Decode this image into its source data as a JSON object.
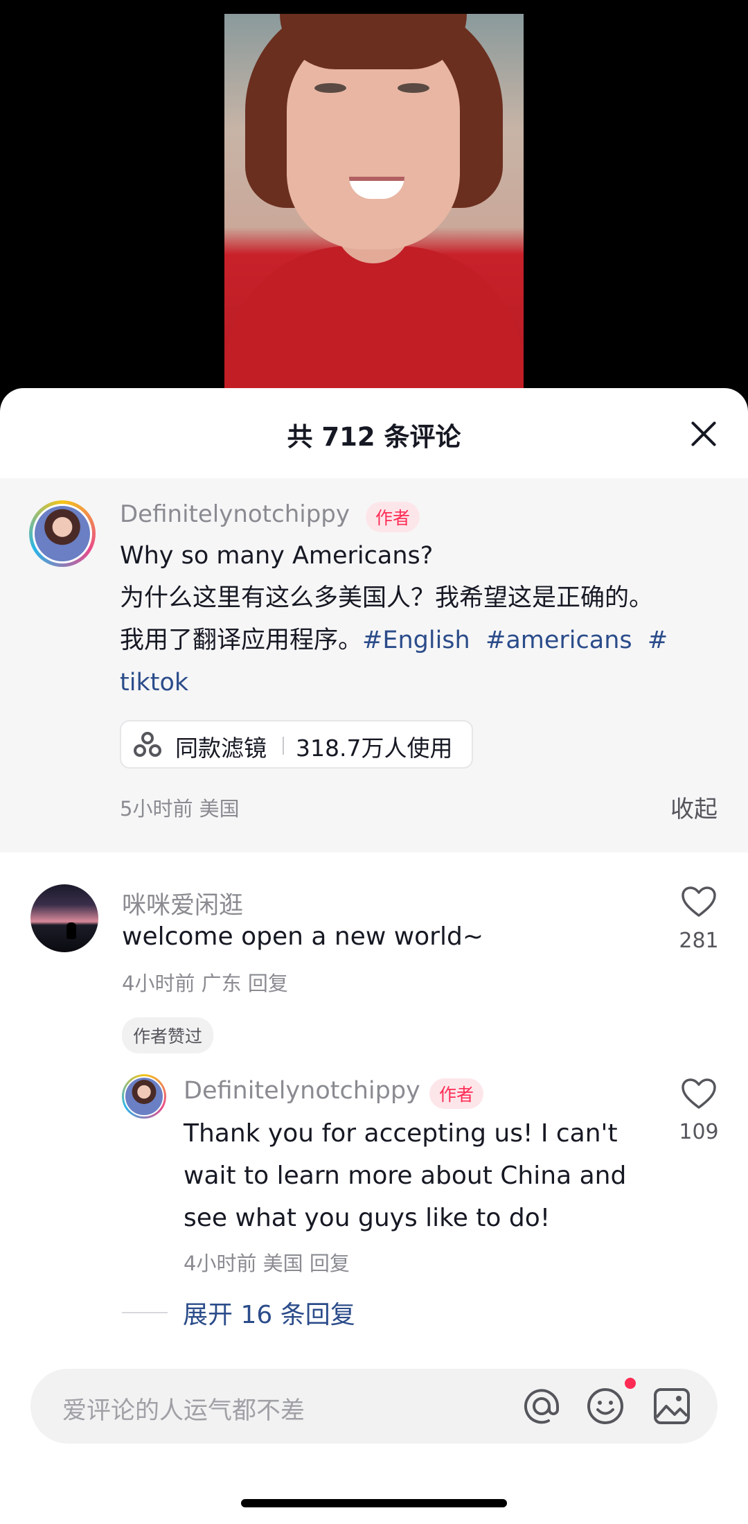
{
  "header": {
    "title": "共 712 条评论"
  },
  "pinned_comment": {
    "username": "Definitelynotchippy",
    "author_tag": "作者",
    "text_line1": "Why so many Americans?",
    "text_line2": "为什么这里有这么多美国人？我希望这是正确的。",
    "text_line3_plain": "我用了翻译应用程序。",
    "hashtags": [
      "#English",
      "#americans",
      "#",
      "tiktok"
    ],
    "filter": {
      "label": "同款滤镜",
      "count": "318.7万人使用"
    },
    "time": "5小时前",
    "location": "美国",
    "collapse_label": "收起"
  },
  "comments": [
    {
      "username": "咪咪爱闲逛",
      "text": "welcome open a new world~",
      "time": "4小时前",
      "location": "广东",
      "reply_label": "回复",
      "likes": "281",
      "badge": "作者赞过",
      "replies": [
        {
          "username": "Definitelynotchippy",
          "author_tag": "作者",
          "text_line1": "Thank you for accepting us! I can't",
          "text_line2": "wait to learn more about China and",
          "text_line3": "see what you guys like to do!",
          "time": "4小时前",
          "location": "美国",
          "reply_label": "回复",
          "likes": "109"
        }
      ],
      "expand_label": "展开 16 条回复"
    }
  ],
  "input": {
    "placeholder": "爱评论的人运气都不差"
  },
  "icons": {
    "mention": "at-icon",
    "emoji": "emoji-icon",
    "image": "image-icon",
    "like": "heart-icon",
    "close": "close-icon",
    "filter": "filter-icon"
  },
  "colors": {
    "accent": "#fe2c55",
    "hashtag": "#2b4c8a"
  }
}
